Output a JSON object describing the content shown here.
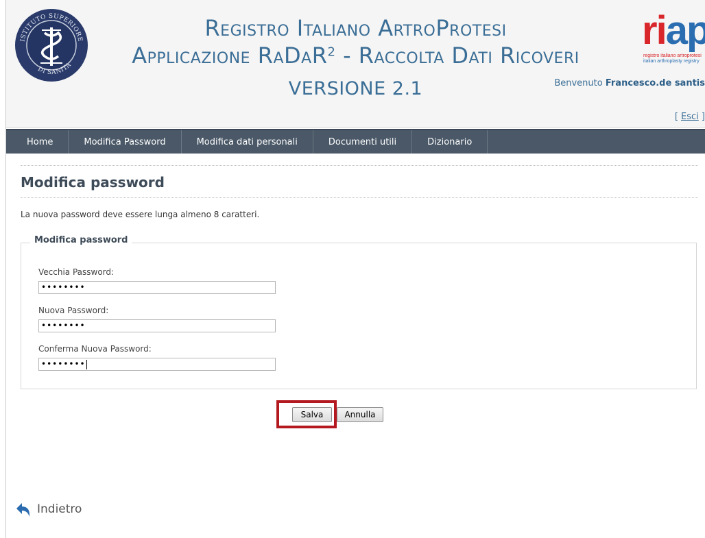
{
  "header": {
    "title_line1": "Registro Italiano ArtroProtesi",
    "title_line2": "Applicazione RaDaR",
    "title_line2_sup": "2",
    "title_line2_rest": " - Raccolta Dati Ricoveri",
    "version": "VERSIONE 2.1",
    "seal_text": "ISTITUTO SUPERIORE DI SANITA",
    "logo": {
      "word": "riap",
      "sub1": "registro italiano artroprotesi",
      "sub2": "italian arthroplasty registry"
    },
    "welcome_prefix": "Benvenuto ",
    "welcome_user": "Francesco.de santis",
    "logout_open": "[ ",
    "logout_label": "Esci",
    "logout_close": " ]"
  },
  "nav": {
    "items": [
      {
        "label": "Home"
      },
      {
        "label": "Modifica Password"
      },
      {
        "label": "Modifica dati personali"
      },
      {
        "label": "Documenti utili"
      },
      {
        "label": "Dizionario"
      }
    ]
  },
  "page": {
    "title": "Modifica password",
    "info": "La nuova password deve essere lunga almeno 8 caratteri.",
    "fieldset_legend": "Modifica password",
    "fields": [
      {
        "label": "Vecchia Password:",
        "value": "••••••••"
      },
      {
        "label": "Nuova Password:",
        "value": "••••••••"
      },
      {
        "label": "Conferma Nuova Password:",
        "value": "••••••••"
      }
    ],
    "save_label": "Salva",
    "cancel_label": "Annulla",
    "back_label": "Indietro"
  },
  "colors": {
    "title_blue": "#3b6e96",
    "nav_bg": "#4a5867",
    "highlight_red": "#b3191f"
  }
}
